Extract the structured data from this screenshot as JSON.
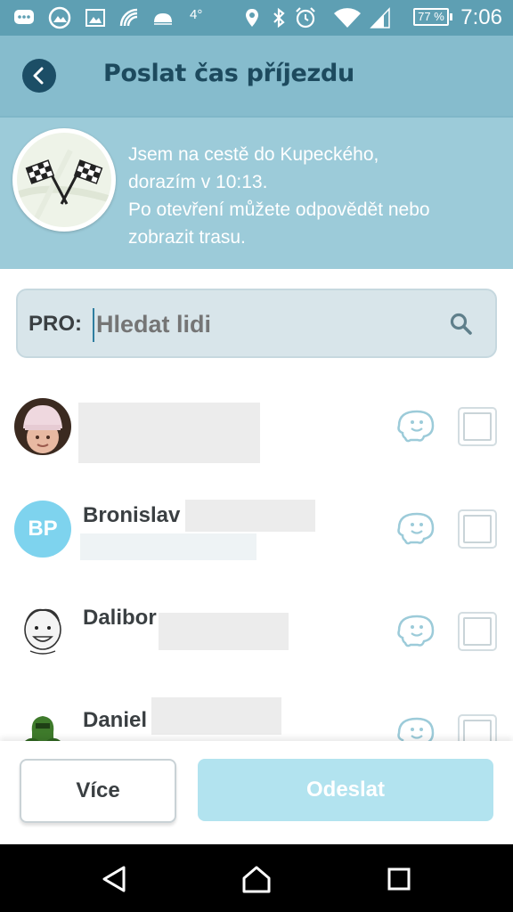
{
  "status_bar": {
    "signal_number": "4°",
    "battery": "77 %",
    "time": "7:06",
    "icons": [
      "chat-icon",
      "gallery-icon",
      "image-icon",
      "nfc-icon",
      "cloud-icon",
      "location-icon",
      "bluetooth-icon",
      "alarm-icon",
      "wifi-icon",
      "cell-signal-icon",
      "battery-icon"
    ]
  },
  "header": {
    "title": "Poslat čas příjezdu",
    "back_icon": "back-arrow-icon"
  },
  "message": {
    "line1": "Jsem na cestě do Kupeckého,",
    "line2": "dorazím v 10:13.",
    "line3": "Po otevření můžete odpovědět nebo",
    "line4": "zobrazit trasu.",
    "image_icon": "checkered-flags-icon"
  },
  "search": {
    "prefix": "PRO:",
    "placeholder": "Hledat lidi"
  },
  "contacts": [
    {
      "name": "",
      "initials": "",
      "avatar": "photo"
    },
    {
      "name": "Bronislav",
      "initials": "BP",
      "avatar": "initials"
    },
    {
      "name": "Dalibor",
      "initials": "",
      "avatar": "caricature"
    },
    {
      "name": "Daniel",
      "initials": "",
      "avatar": "hulk"
    }
  ],
  "buttons": {
    "more": "Více",
    "send": "Odeslat"
  },
  "colors": {
    "status_bar": "#5e9fb3",
    "header": "#86bccd",
    "banner": "#9ccbd9",
    "title_text": "#1d4a5e",
    "accent_light": "#b2e3ef",
    "initials_bg": "#7ed3ee"
  }
}
